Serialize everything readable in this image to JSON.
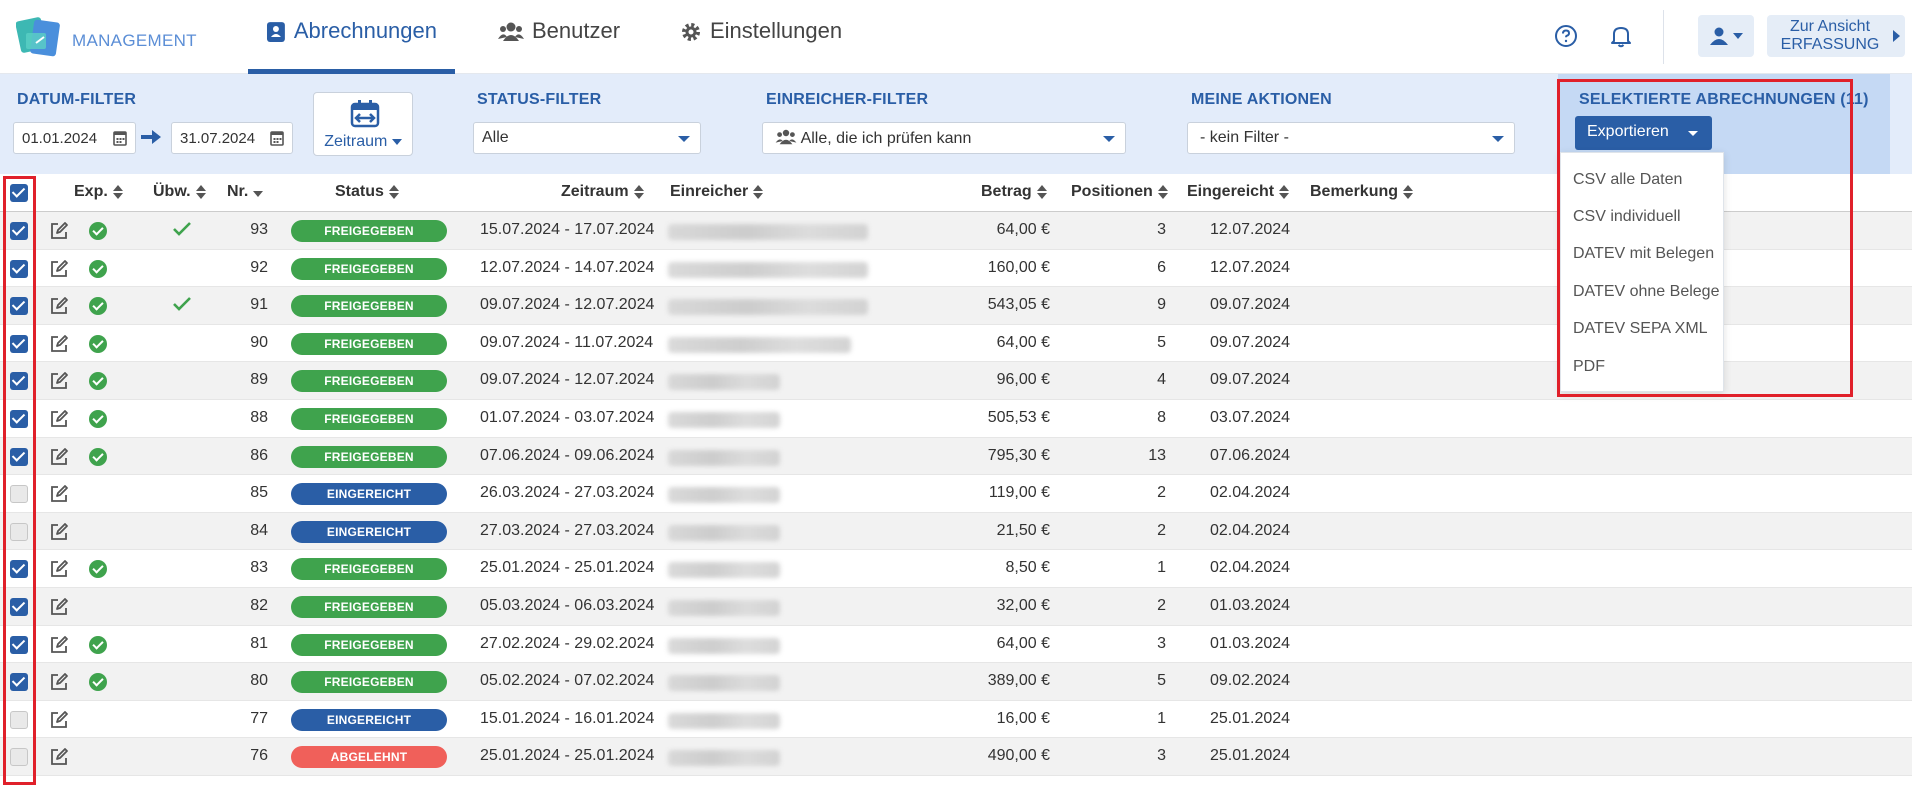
{
  "brand": {
    "name": "MANAGEMENT"
  },
  "nav": {
    "tabs": [
      {
        "label": "Abrechnungen",
        "icon": "invoice-person-icon",
        "active": true
      },
      {
        "label": "Benutzer",
        "icon": "users-icon",
        "active": false
      },
      {
        "label": "Einstellungen",
        "icon": "gear-icon",
        "active": false
      }
    ],
    "view_button": {
      "line1": "Zur Ansicht",
      "line2": "ERFASSUNG"
    }
  },
  "filters": {
    "date": {
      "label": "DATUM-FILTER",
      "from": "01.01.2024",
      "to": "31.07.2024",
      "period_button": "Zeitraum"
    },
    "status": {
      "label": "STATUS-FILTER",
      "value": "Alle"
    },
    "submitter": {
      "label": "EINREICHER-FILTER",
      "value": "Alle, die ich prüfen kann"
    },
    "actions": {
      "label": "MEINE AKTIONEN",
      "value": "- kein Filter -"
    }
  },
  "selection": {
    "label": "SELEKTIERTE ABRECHNUNGEN (11)",
    "export_button": "Exportieren",
    "export_options": [
      "CSV alle Daten",
      "CSV individuell",
      "DATEV mit Belegen",
      "DATEV ohne Belege",
      "DATEV SEPA XML",
      "PDF"
    ]
  },
  "table": {
    "headers": {
      "exp": "Exp.",
      "uebw": "Übw.",
      "nr": "Nr.",
      "status": "Status",
      "zeitraum": "Zeitraum",
      "einreicher": "Einreicher",
      "betrag": "Betrag",
      "positionen": "Positionen",
      "eingereicht": "Eingereicht",
      "bemerkung": "Bemerkung"
    },
    "rows": [
      {
        "checked": true,
        "exp": true,
        "uebw": true,
        "nr": "93",
        "status": "FREIGEGEBEN",
        "zeitraum": "15.07.2024 - 17.07.2024",
        "betrag": "64,00 €",
        "positionen": "3",
        "eingereicht": "12.07.2024"
      },
      {
        "checked": true,
        "exp": true,
        "uebw": false,
        "nr": "92",
        "status": "FREIGEGEBEN",
        "zeitraum": "12.07.2024 - 14.07.2024",
        "betrag": "160,00 €",
        "positionen": "6",
        "eingereicht": "12.07.2024"
      },
      {
        "checked": true,
        "exp": true,
        "uebw": true,
        "nr": "91",
        "status": "FREIGEGEBEN",
        "zeitraum": "09.07.2024 - 12.07.2024",
        "betrag": "543,05 €",
        "positionen": "9",
        "eingereicht": "09.07.2024"
      },
      {
        "checked": true,
        "exp": true,
        "uebw": false,
        "nr": "90",
        "status": "FREIGEGEBEN",
        "zeitraum": "09.07.2024 - 11.07.2024",
        "betrag": "64,00 €",
        "positionen": "5",
        "eingereicht": "09.07.2024"
      },
      {
        "checked": true,
        "exp": true,
        "uebw": false,
        "nr": "89",
        "status": "FREIGEGEBEN",
        "zeitraum": "09.07.2024 - 12.07.2024",
        "betrag": "96,00 €",
        "positionen": "4",
        "eingereicht": "09.07.2024"
      },
      {
        "checked": true,
        "exp": true,
        "uebw": false,
        "nr": "88",
        "status": "FREIGEGEBEN",
        "zeitraum": "01.07.2024 - 03.07.2024",
        "betrag": "505,53 €",
        "positionen": "8",
        "eingereicht": "03.07.2024"
      },
      {
        "checked": true,
        "exp": true,
        "uebw": false,
        "nr": "86",
        "status": "FREIGEGEBEN",
        "zeitraum": "07.06.2024 - 09.06.2024",
        "betrag": "795,30 €",
        "positionen": "13",
        "eingereicht": "07.06.2024"
      },
      {
        "checked": false,
        "exp": false,
        "uebw": false,
        "nr": "85",
        "status": "EINGEREICHT",
        "zeitraum": "26.03.2024 - 27.03.2024",
        "betrag": "119,00 €",
        "positionen": "2",
        "eingereicht": "02.04.2024"
      },
      {
        "checked": false,
        "exp": false,
        "uebw": false,
        "nr": "84",
        "status": "EINGEREICHT",
        "zeitraum": "27.03.2024 - 27.03.2024",
        "betrag": "21,50 €",
        "positionen": "2",
        "eingereicht": "02.04.2024"
      },
      {
        "checked": true,
        "exp": true,
        "uebw": false,
        "nr": "83",
        "status": "FREIGEGEBEN",
        "zeitraum": "25.01.2024 - 25.01.2024",
        "betrag": "8,50 €",
        "positionen": "1",
        "eingereicht": "02.04.2024"
      },
      {
        "checked": true,
        "exp": false,
        "uebw": false,
        "nr": "82",
        "status": "FREIGEGEBEN",
        "zeitraum": "05.03.2024 - 06.03.2024",
        "betrag": "32,00 €",
        "positionen": "2",
        "eingereicht": "01.03.2024"
      },
      {
        "checked": true,
        "exp": true,
        "uebw": false,
        "nr": "81",
        "status": "FREIGEGEBEN",
        "zeitraum": "27.02.2024 - 29.02.2024",
        "betrag": "64,00 €",
        "positionen": "3",
        "eingereicht": "01.03.2024"
      },
      {
        "checked": true,
        "exp": true,
        "uebw": false,
        "nr": "80",
        "status": "FREIGEGEBEN",
        "zeitraum": "05.02.2024 - 07.02.2024",
        "betrag": "389,00 €",
        "positionen": "5",
        "eingereicht": "09.02.2024"
      },
      {
        "checked": false,
        "exp": false,
        "uebw": false,
        "nr": "77",
        "status": "EINGEREICHT",
        "zeitraum": "15.01.2024 - 16.01.2024",
        "betrag": "16,00 €",
        "positionen": "1",
        "eingereicht": "25.01.2024"
      },
      {
        "checked": false,
        "exp": false,
        "uebw": false,
        "nr": "76",
        "status": "ABGELEHNT",
        "zeitraum": "25.01.2024 - 25.01.2024",
        "betrag": "490,00 €",
        "positionen": "3",
        "eingereicht": "25.01.2024"
      }
    ]
  },
  "colors": {
    "primary": "#2a5ea6",
    "freigegeben": "#3fa34d",
    "eingereicht": "#2a5ea6",
    "abgelehnt": "#f0605a",
    "highlight": "#e0202a"
  }
}
